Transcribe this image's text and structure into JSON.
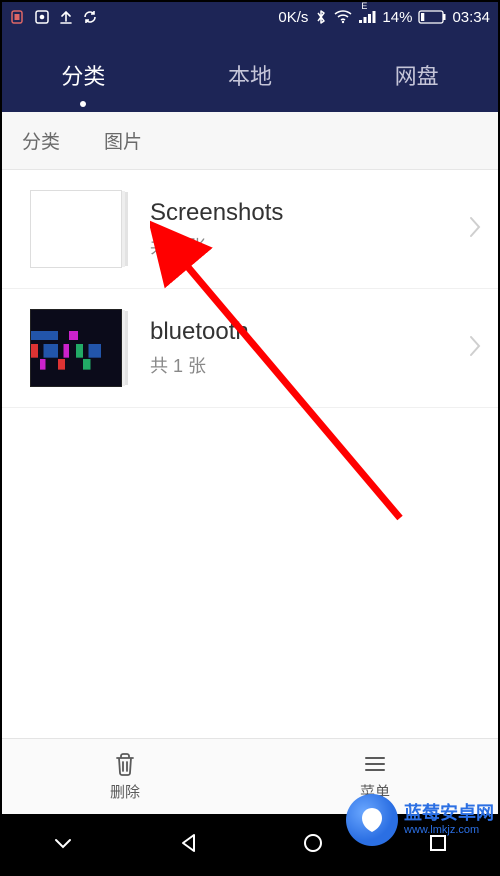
{
  "status_bar": {
    "net_speed": "0K/s",
    "signal_label": "E",
    "battery_pct": "14%",
    "time": "03:34"
  },
  "tabs": {
    "category": "分类",
    "local": "本地",
    "cloud": "网盘",
    "active_index": 0
  },
  "breadcrumb": {
    "root": "分类",
    "current": "图片"
  },
  "folders": [
    {
      "title": "Screenshots",
      "count_text": "共 4 张"
    },
    {
      "title": "bluetooth",
      "count_text": "共 1 张"
    }
  ],
  "actions": {
    "delete": "删除",
    "menu": "菜单"
  },
  "watermark": {
    "name": "蓝莓安卓网",
    "url": "www.lmkjz.com"
  }
}
